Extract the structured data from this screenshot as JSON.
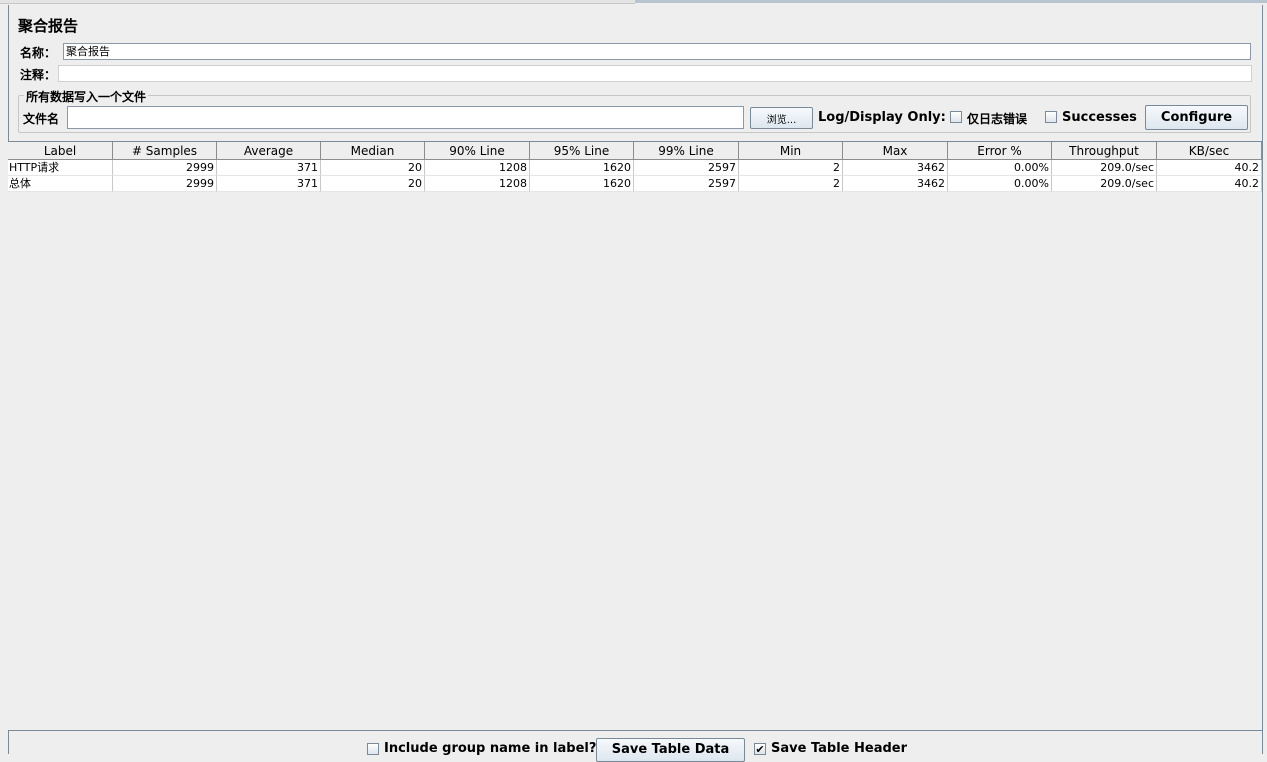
{
  "panel": {
    "title": "聚合报告",
    "name_label": "名称：",
    "name_value": "聚合报告",
    "comment_label": "注释：",
    "comment_value": ""
  },
  "file_section": {
    "legend": "所有数据写入一个文件",
    "filename_label": "文件名",
    "filename_value": "",
    "browse_label": "浏览...",
    "log_display_label": "Log/Display Only:",
    "errors_only_label": "仅日志错误",
    "errors_only_checked": false,
    "successes_label": "Successes",
    "successes_checked": false,
    "configure_label": "Configure"
  },
  "table": {
    "columns": [
      "Label",
      "# Samples",
      "Average",
      "Median",
      "90% Line",
      "95% Line",
      "99% Line",
      "Min",
      "Max",
      "Error %",
      "Throughput",
      "KB/sec"
    ],
    "rows": [
      [
        "HTTP请求",
        "2999",
        "371",
        "20",
        "1208",
        "1620",
        "2597",
        "2",
        "3462",
        "0.00%",
        "209.0/sec",
        "40.2"
      ],
      [
        "总体",
        "2999",
        "371",
        "20",
        "1208",
        "1620",
        "2597",
        "2",
        "3462",
        "0.00%",
        "209.0/sec",
        "40.2"
      ]
    ]
  },
  "bottom": {
    "include_group_label": "Include group name in label?",
    "include_group_checked": false,
    "save_table_data_label": "Save Table Data",
    "save_table_header_label": "Save Table Header",
    "save_table_header_checked": true
  }
}
